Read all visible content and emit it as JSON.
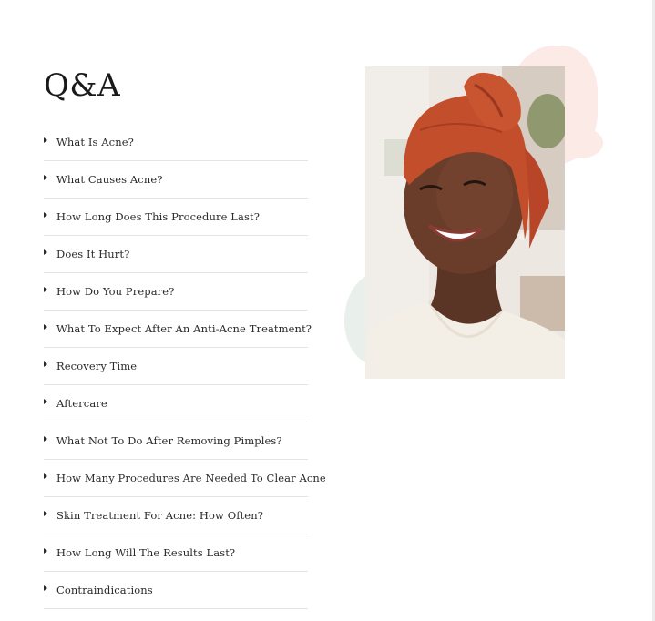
{
  "qa": {
    "title": "Q&A",
    "items": [
      {
        "label": "What Is Acne?"
      },
      {
        "label": "What Causes Acne?"
      },
      {
        "label": "How Long Does This Procedure Last?"
      },
      {
        "label": "Does It Hurt?"
      },
      {
        "label": "How Do You Prepare?"
      },
      {
        "label": "What To Expect After An Anti-Acne Treatment?"
      },
      {
        "label": "Recovery Time"
      },
      {
        "label": "Aftercare"
      },
      {
        "label": "What Not To Do After Removing Pimples?"
      },
      {
        "label": "How Many Procedures Are Needed To Clear Acne"
      },
      {
        "label": "Skin Treatment For Acne: How Often?"
      },
      {
        "label": "How Long Will The Results Last?"
      },
      {
        "label": "Contraindications"
      }
    ]
  },
  "colors": {
    "accent_pink": "#fbeae6",
    "accent_mint": "#e9efeb",
    "text": "#2a2a2a",
    "divider": "#e4e4e4"
  },
  "icons": {
    "item_marker": "caret-right-icon"
  }
}
